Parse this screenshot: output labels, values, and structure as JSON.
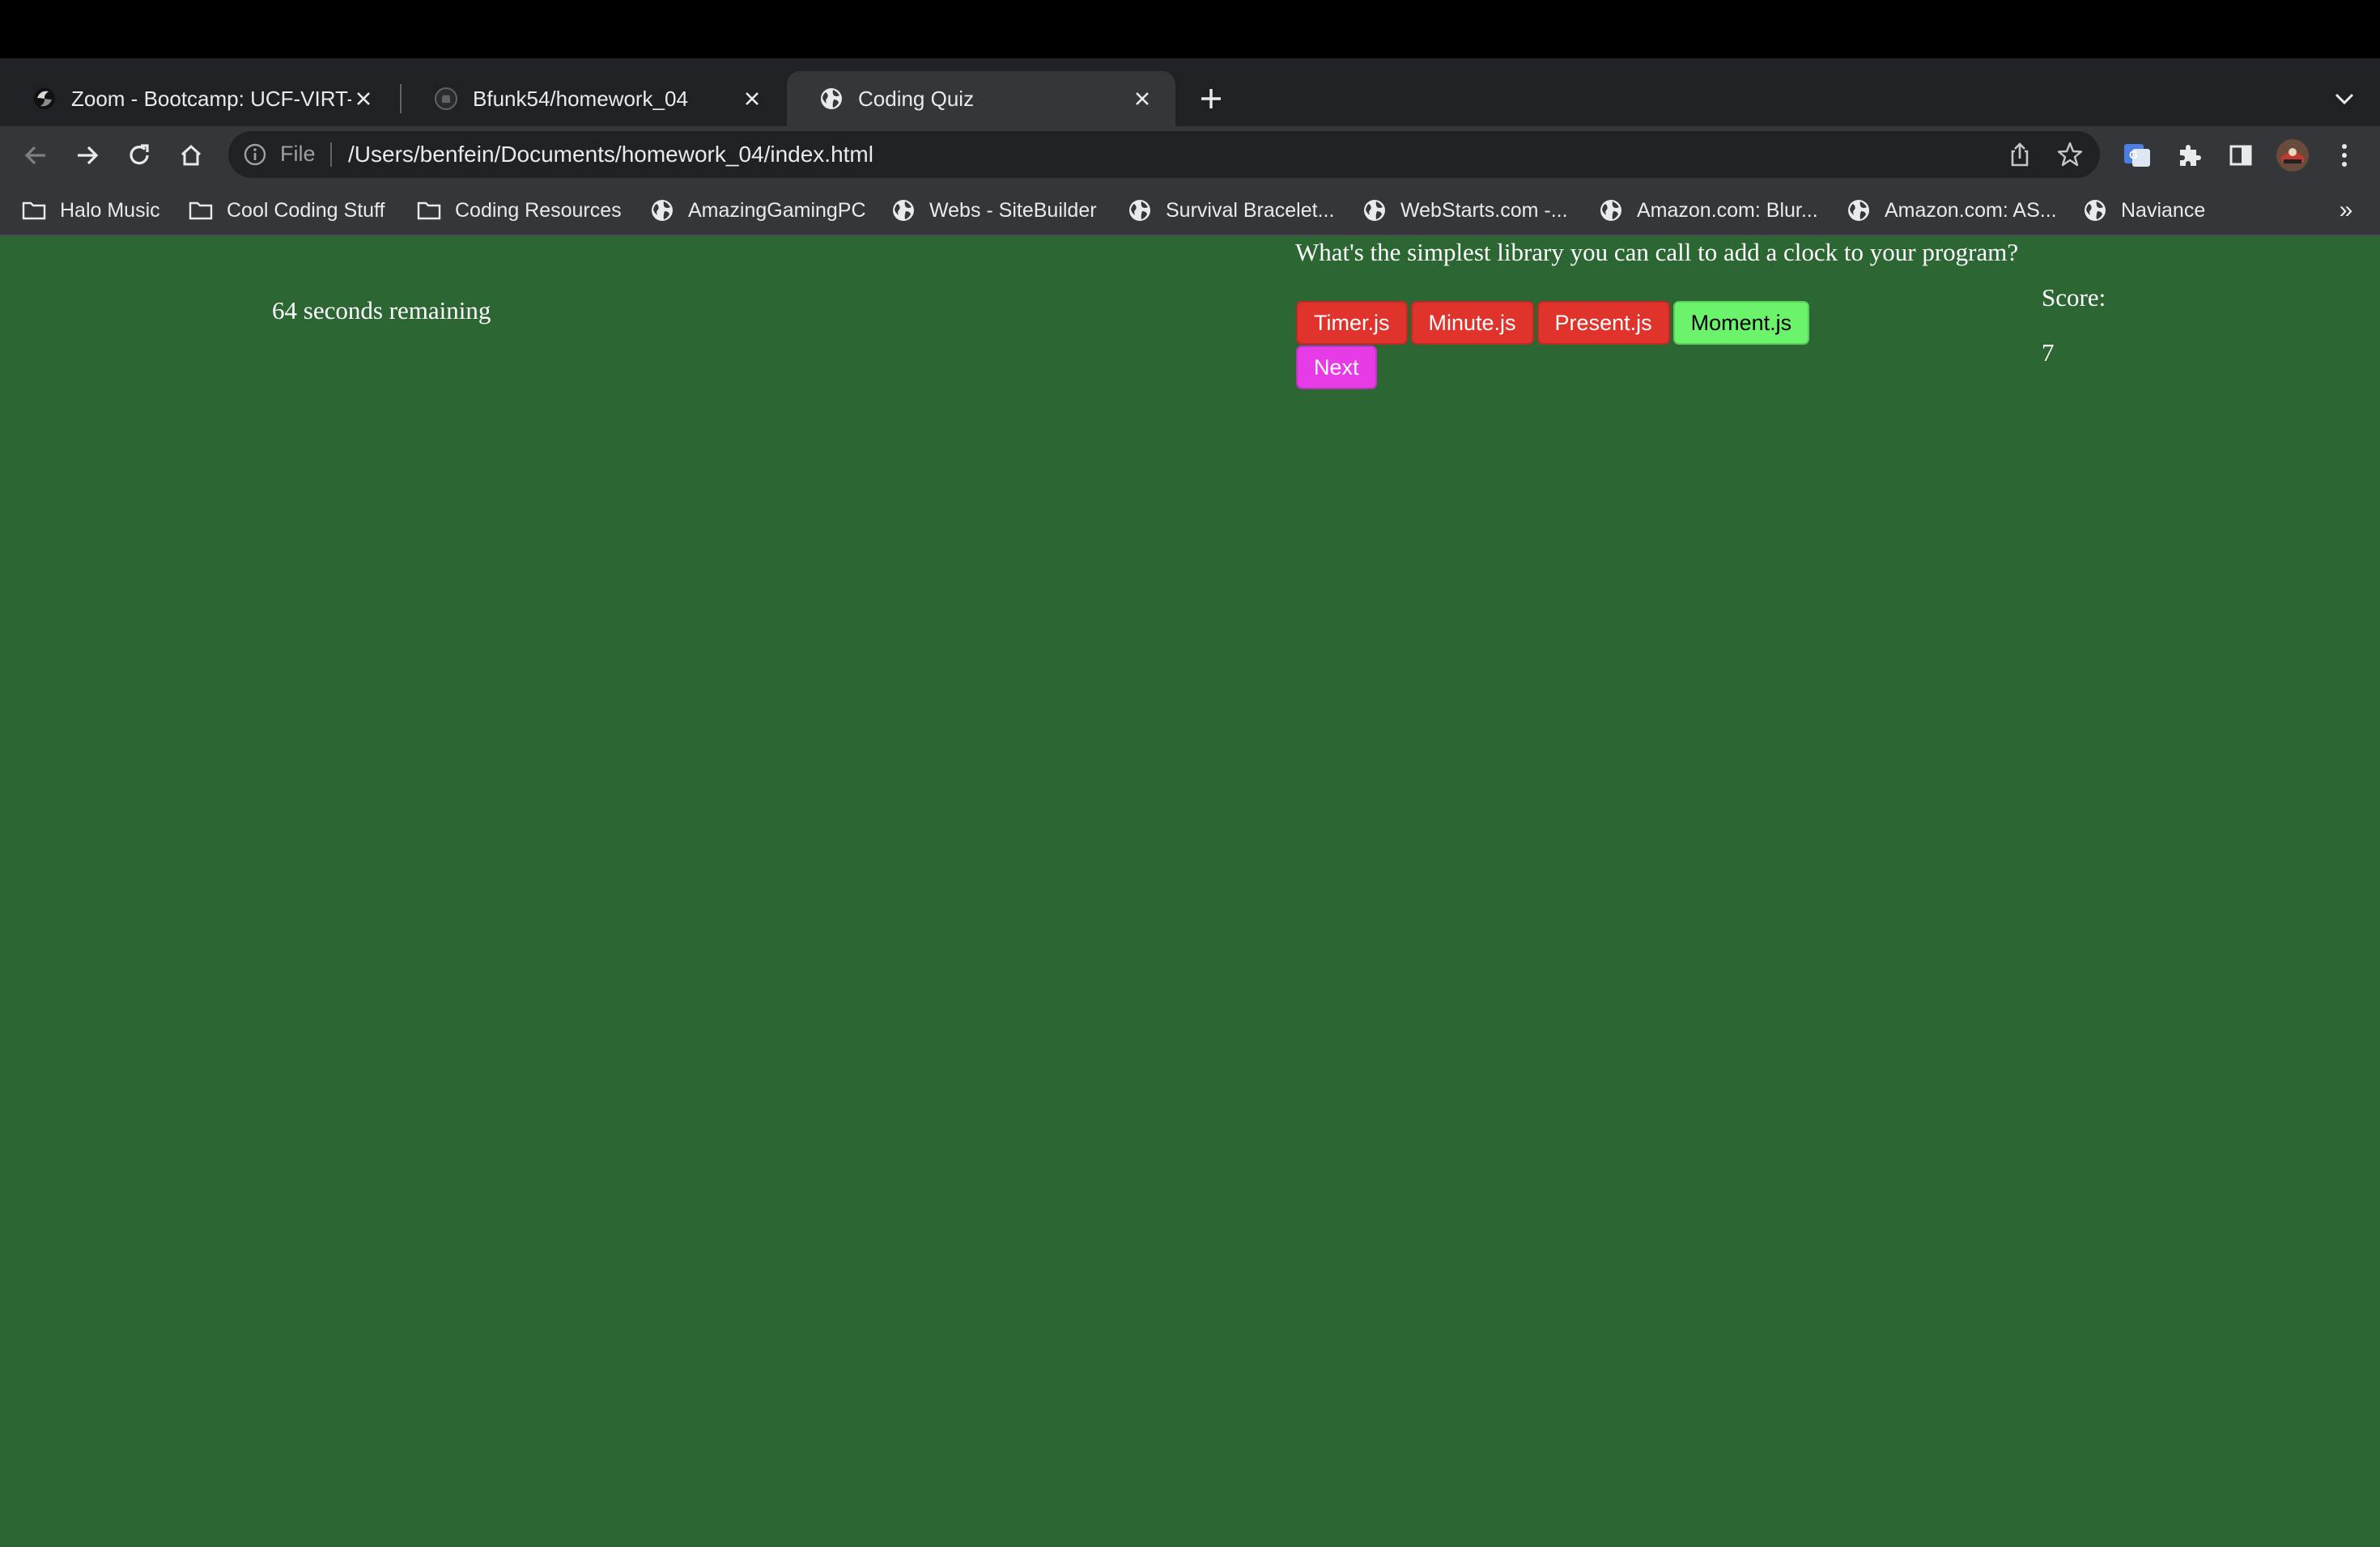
{
  "browser": {
    "tabs": [
      {
        "title": "Zoom - Bootcamp: UCF-VIRT-F",
        "icon": "zoom-favicon-icon",
        "active": false
      },
      {
        "title": "Bfunk54/homework_04",
        "icon": "github-favicon-icon",
        "active": false
      },
      {
        "title": "Coding Quiz",
        "icon": "globe-favicon-icon",
        "active": true
      }
    ],
    "address": {
      "scheme": "File",
      "url": "/Users/benfein/Documents/homework_04/index.html"
    },
    "bookmarks": [
      {
        "label": "Halo Music",
        "icon": "folder-icon"
      },
      {
        "label": "Cool Coding Stuff",
        "icon": "folder-icon"
      },
      {
        "label": "Coding Resources",
        "icon": "folder-icon"
      },
      {
        "label": "AmazingGamingPC",
        "icon": "globe-icon"
      },
      {
        "label": "Webs - SiteBuilder",
        "icon": "globe-icon"
      },
      {
        "label": "Survival Bracelet...",
        "icon": "globe-icon"
      },
      {
        "label": "WebStarts.com -...",
        "icon": "globe-icon"
      },
      {
        "label": "Amazon.com: Blur...",
        "icon": "globe-icon"
      },
      {
        "label": "Amazon.com: AS...",
        "icon": "globe-icon"
      },
      {
        "label": "Naviance",
        "icon": "globe-icon"
      }
    ],
    "bookmarks_overflow": "»",
    "colors": {
      "chrome_dark": "#202124",
      "chrome_toolbar": "#35363a",
      "text": "#e8eaed"
    }
  },
  "quiz": {
    "timer_text": "64 seconds remaining",
    "question": "What's the simplest library you can call to add a clock to your program?",
    "answers": [
      {
        "label": "Timer.js",
        "state": "wrong"
      },
      {
        "label": "Minute.js",
        "state": "wrong"
      },
      {
        "label": "Present.js",
        "state": "wrong"
      },
      {
        "label": "Moment.js",
        "state": "correct"
      }
    ],
    "next_label": "Next",
    "score_label": "Score:",
    "score_value": "7",
    "colors": {
      "background": "#2b6633",
      "wrong": "#e0332c",
      "correct": "#6cf36c",
      "next": "#e63be6"
    }
  }
}
